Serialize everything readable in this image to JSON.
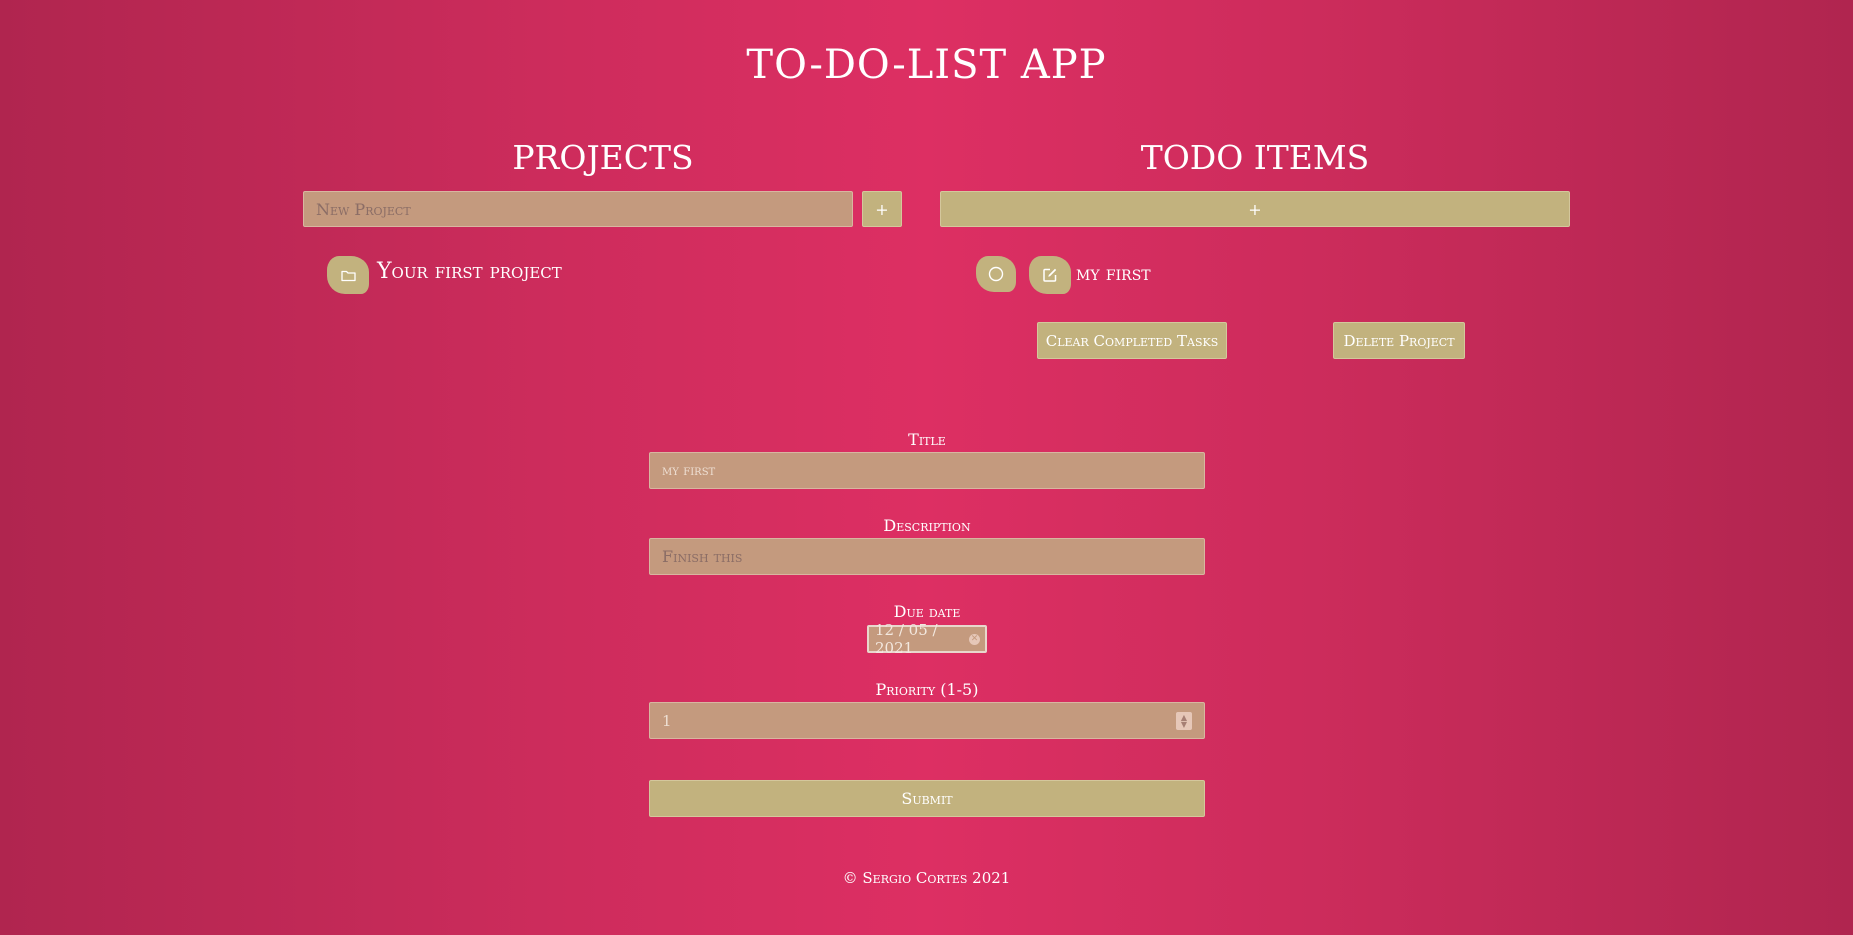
{
  "app": {
    "title": "TO-DO-LIST APP"
  },
  "projects": {
    "title": "PROJECTS",
    "new_project_placeholder": "New Project",
    "add_button_label": "+",
    "items": [
      {
        "label": "Your first project",
        "icon": "folder-icon"
      }
    ]
  },
  "todos": {
    "title": "TODO ITEMS",
    "add_button_label": "+",
    "items": [
      {
        "label": "my first",
        "check_icon": "circle-icon",
        "edit_icon": "edit-icon"
      }
    ],
    "clear_completed_label": "Clear Completed Tasks",
    "delete_project_label": "Delete Project"
  },
  "form": {
    "title_label": "Title",
    "title_value": "my first",
    "description_label": "Description",
    "description_placeholder": "Finish this",
    "due_date_label": "Due date",
    "due_date_value": "12 / 05 / 2021",
    "priority_label": "Priority (1-5)",
    "priority_value": "1",
    "submit_label": "Submit"
  },
  "footer": {
    "text": "© Sergio Cortes 2021"
  },
  "colors": {
    "background": "#dd2f63",
    "button": "#c2b27e",
    "input": "#c49a7e"
  }
}
